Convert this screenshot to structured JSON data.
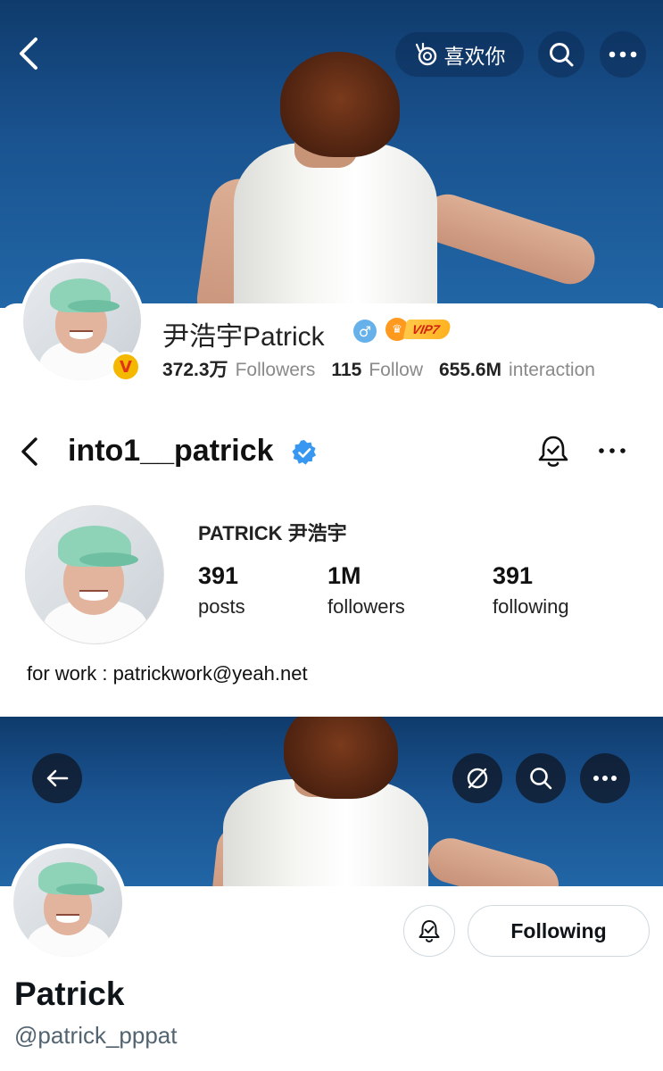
{
  "weibo": {
    "like_button": {
      "label": "喜欢你",
      "icon": "snail-icon"
    },
    "profile": {
      "name": "尹浩宇Patrick",
      "gender_icon": "♂",
      "vip_label": "VIP7",
      "verified_badge": "V",
      "stats": [
        {
          "value": "372.3万",
          "label": "Followers"
        },
        {
          "value": "115",
          "label": "Follow"
        },
        {
          "value": "655.6M",
          "label": "interaction"
        }
      ]
    },
    "colors": {
      "banner": "#1a5390",
      "vip": "#ffb11f",
      "verified": "#f5b800"
    }
  },
  "instagram": {
    "username": "into1__patrick",
    "full_name": "PATRICK 尹浩宇",
    "stats": [
      {
        "value": "391",
        "label": "posts"
      },
      {
        "value": "1M",
        "label": "followers"
      },
      {
        "value": "391",
        "label": "following"
      }
    ],
    "bio": "for work : patrickwork@yeah.net",
    "colors": {
      "verified": "#3897f0"
    }
  },
  "twitter": {
    "name": "Patrick",
    "handle": "@patrick_pppat",
    "following_label": "Following",
    "colors": {
      "border": "#cfd9de",
      "handle": "#536471"
    }
  }
}
